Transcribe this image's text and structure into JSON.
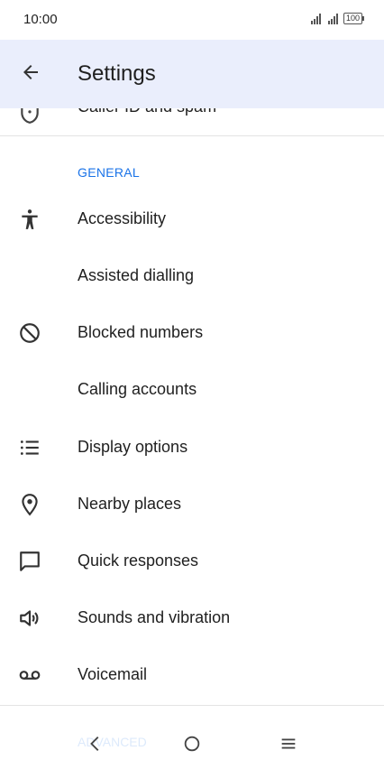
{
  "status_bar": {
    "time": "10:00",
    "battery": "100"
  },
  "header": {
    "title": "Settings"
  },
  "partial_item": {
    "label": "Caller ID and spam"
  },
  "general_section": {
    "header": "GENERAL",
    "items": [
      {
        "label": "Accessibility",
        "icon": "accessibility-icon"
      },
      {
        "label": "Assisted dialling",
        "icon": ""
      },
      {
        "label": "Blocked numbers",
        "icon": "block-icon"
      },
      {
        "label": "Calling accounts",
        "icon": ""
      },
      {
        "label": "Display options",
        "icon": "list-icon"
      },
      {
        "label": "Nearby places",
        "icon": "location-pin-icon"
      },
      {
        "label": "Quick responses",
        "icon": "chat-bubble-icon"
      },
      {
        "label": "Sounds and vibration",
        "icon": "speaker-icon"
      },
      {
        "label": "Voicemail",
        "icon": "voicemail-icon"
      }
    ]
  },
  "advanced_section": {
    "header": "ADVANCED"
  },
  "colors": {
    "app_bar": "#eaeefc",
    "accent": "#1a73e8"
  }
}
